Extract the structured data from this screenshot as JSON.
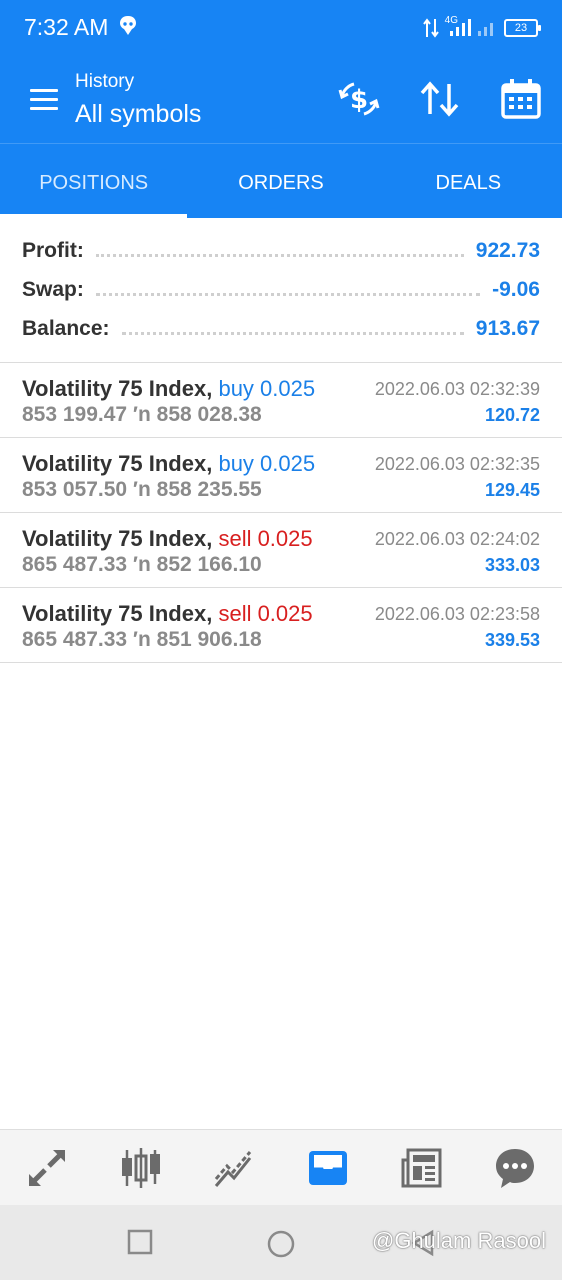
{
  "status_bar": {
    "time": "7:32 AM",
    "network": "4G",
    "battery": "23"
  },
  "app_bar": {
    "subtitle": "History",
    "title": "All symbols",
    "icons": [
      "menu-icon",
      "currency-exchange-icon",
      "sort-icon",
      "calendar-icon"
    ]
  },
  "tabs": [
    {
      "label": "POSITIONS",
      "active": true
    },
    {
      "label": "ORDERS",
      "active": false
    },
    {
      "label": "DEALS",
      "active": false
    }
  ],
  "summary": {
    "profit_label": "Profit:",
    "profit_value": "922.73",
    "swap_label": "Swap:",
    "swap_value": "-9.06",
    "balance_label": "Balance:",
    "balance_value": "913.67"
  },
  "positions": [
    {
      "symbol": "Volatility 75 Index,",
      "direction": "buy",
      "volume": "buy 0.025",
      "prices": "853 199.47 ′n  858 028.38",
      "time": "2022.06.03 02:32:39",
      "profit": "120.72"
    },
    {
      "symbol": "Volatility 75 Index,",
      "direction": "buy",
      "volume": "buy 0.025",
      "prices": "853 057.50 ′n  858 235.55",
      "time": "2022.06.03 02:32:35",
      "profit": "129.45"
    },
    {
      "symbol": "Volatility 75 Index,",
      "direction": "sell",
      "volume": "sell 0.025",
      "prices": "865 487.33 ′n  852 166.10",
      "time": "2022.06.03 02:24:02",
      "profit": "333.03"
    },
    {
      "symbol": "Volatility 75 Index,",
      "direction": "sell",
      "volume": "sell 0.025",
      "prices": "865 487.33 ′n  851 906.18",
      "time": "2022.06.03 02:23:58",
      "profit": "339.53"
    }
  ],
  "bottom_nav": [
    {
      "name": "quotes",
      "icon": "quotes-arrows-icon",
      "active": false
    },
    {
      "name": "chart",
      "icon": "candlestick-icon",
      "active": false
    },
    {
      "name": "trade",
      "icon": "trend-icon",
      "active": false
    },
    {
      "name": "history",
      "icon": "inbox-icon",
      "active": true
    },
    {
      "name": "news",
      "icon": "news-icon",
      "active": false
    },
    {
      "name": "messages",
      "icon": "chat-icon",
      "active": false
    }
  ],
  "colors": {
    "primary": "#1784f4",
    "value_blue": "#1b80e8",
    "sell_red": "#d81f1f",
    "muted_gray": "#8a8a8a"
  },
  "watermark": "@Ghulam Rasool"
}
